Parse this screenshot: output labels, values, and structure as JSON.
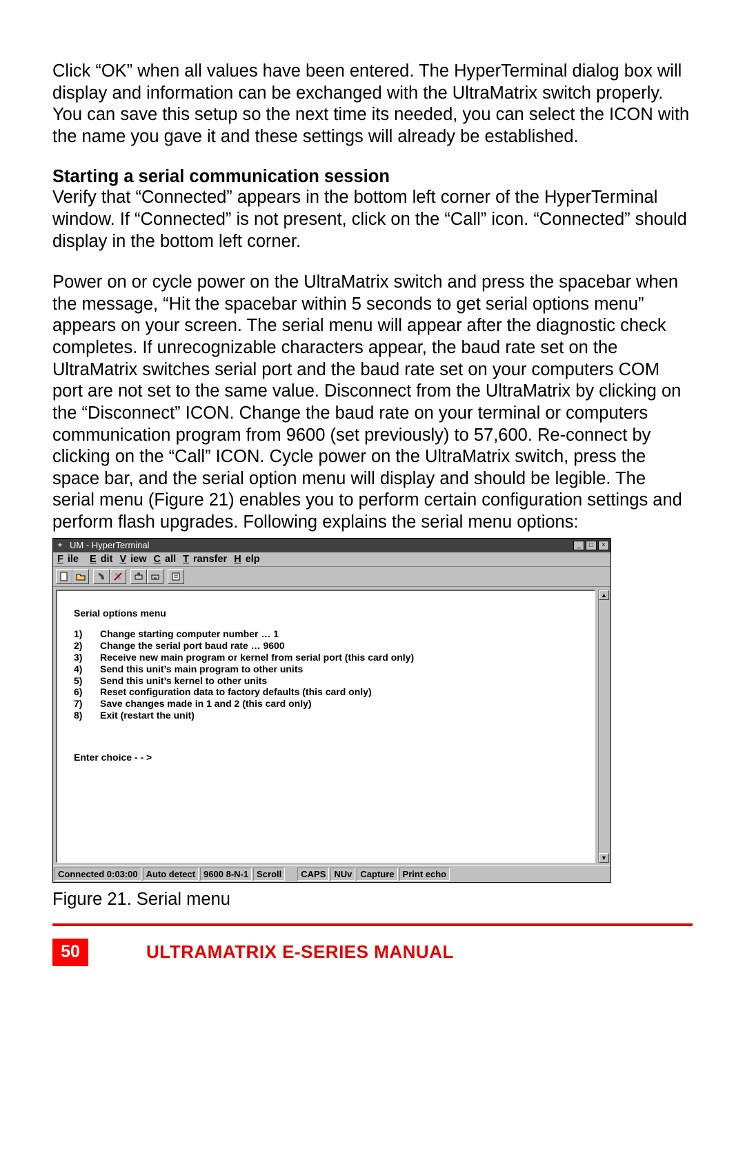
{
  "paragraphs": {
    "p1": "Click “OK” when all values have been entered.  The HyperTerminal dialog box will display and information can be exchanged with the UltraMatrix switch properly. You can save this setup so the next time its needed, you can select the ICON with the name you gave it and these settings will already be established.",
    "heading": "Starting a serial communication session",
    "p2": "Verify that “Connected” appears in the bottom left corner of the HyperTerminal window. If “Connected” is not present, click on the “Call” icon.  “Connected” should display in the bottom left corner.",
    "p3": "Power on or cycle power on the UltraMatrix switch and press the spacebar when the message, “Hit the spacebar within 5 seconds to get serial options menu” appears on your screen. The serial menu will appear after the diagnostic check completes. If unrecognizable characters appear, the baud rate set on the UltraMatrix switches serial port and the baud rate set on your computers COM port are not set to the same value.  Disconnect from the UltraMatrix by clicking on the “Disconnect” ICON.  Change the baud rate on your terminal or computers communication program from 9600 (set previously) to 57,600. Re-connect by clicking on the “Call” ICON.  Cycle power on the UltraMatrix switch, press the space bar, and the serial option menu will display and should be legible.  The serial menu (Figure 21) enables you to perform certain configuration settings and perform flash upgrades. Following explains the serial menu options:"
  },
  "window": {
    "title": "UM - HyperTerminal",
    "menus": {
      "file": "File",
      "edit": "Edit",
      "view": "View",
      "call": "Call",
      "transfer": "Transfer",
      "help": "Help"
    }
  },
  "serial_menu": {
    "title": "Serial options menu",
    "items": [
      {
        "n": "1)",
        "t": "Change starting computer number … 1"
      },
      {
        "n": "2)",
        "t": "Change the serial port baud rate     … 9600"
      },
      {
        "n": "3)",
        "t": "Receive new main program or kernel from serial port (this card only)"
      },
      {
        "n": "4)",
        "t": "Send this unit’s main program to other units"
      },
      {
        "n": "5)",
        "t": "Send this unit’s kernel to other units"
      },
      {
        "n": "6)",
        "t": "Reset configuration data to factory defaults (this card only)"
      },
      {
        "n": "7)",
        "t": "Save changes made in 1 and 2 (this card only)"
      },
      {
        "n": "8)",
        "t": "Exit (restart the unit)"
      }
    ],
    "prompt": "Enter choice - - >"
  },
  "statusbar": {
    "connected": "Connected 0:03:00",
    "auto": "Auto detect",
    "mode": "9600 8-N-1",
    "scroll": "Scroll",
    "caps": "CAPS",
    "num": "NUv",
    "capture": "Capture",
    "echo": "Print echo"
  },
  "figure_caption": "Figure 21. Serial menu",
  "footer": {
    "page": "50",
    "title": "ULTRAMATRIX E-SERIES MANUAL"
  }
}
